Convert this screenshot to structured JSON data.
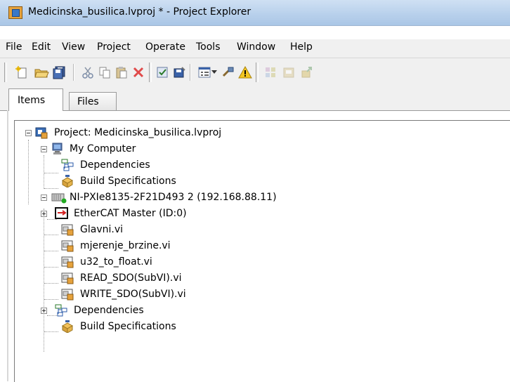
{
  "window": {
    "title": "Medicinska_busilica.lvproj * - Project Explorer"
  },
  "menu": [
    "File",
    "Edit",
    "View",
    "Project",
    "Operate",
    "Tools",
    "Window",
    "Help"
  ],
  "tabs": {
    "items": "Items",
    "files": "Files"
  },
  "tree": {
    "project": "Project: Medicinska_busilica.lvproj",
    "my_computer": "My Computer",
    "mc_dependencies": "Dependencies",
    "mc_build": "Build Specifications",
    "target": "NI-PXIe8135-2F21D493 2 (192.168.88.11)",
    "ethercat": "EtherCAT Master (ID:0)",
    "vi1": "Glavni.vi",
    "vi2": "mjerenje_brzine.vi",
    "vi3": "u32_to_float.vi",
    "vi4": "READ_SDO(SubVI).vi",
    "vi5": "WRITE_SDO(SubVI).vi",
    "t_dependencies": "Dependencies",
    "t_build": "Build Specifications"
  },
  "colors": {
    "titlebar": "#b9d1ec",
    "chrome": "#f0f0f0",
    "project_icon": "#e6a23c",
    "target_status": "#22aa22"
  },
  "icons": {
    "toolbar": [
      "new-icon",
      "open-icon",
      "save-all-icon",
      "cut-icon",
      "copy-icon",
      "paste-icon",
      "delete-icon",
      "properties-icon",
      "build-icon",
      "view-list-icon",
      "deploy-icon",
      "warning-icon",
      "disabled-icon-1",
      "disabled-icon-2",
      "disabled-icon-3"
    ]
  }
}
